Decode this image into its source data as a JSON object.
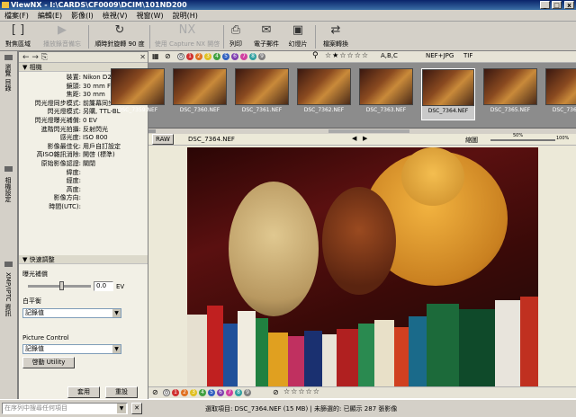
{
  "window": {
    "title": "ViewNX - I:\\CARDS\\CF0009\\DCIM\\101ND200",
    "min": "_",
    "max": "□",
    "close": "x"
  },
  "menu": [
    "檔案(F)",
    "編輯(E)",
    "影像(I)",
    "檢視(V)",
    "視窗(W)",
    "說明(H)"
  ],
  "toolbar": {
    "items": [
      {
        "label": "對焦區域",
        "icon": "[ ]",
        "disabled": false
      },
      {
        "label": "播放錄音備忘",
        "icon": "▶",
        "disabled": true
      },
      {
        "label": "順時針旋轉 90 度",
        "icon": "↻",
        "disabled": false
      },
      {
        "label": "使用 Capture NX 開啓",
        "icon": "NX",
        "disabled": true
      },
      {
        "label": "列印",
        "icon": "⎙",
        "disabled": false
      },
      {
        "label": "電子郵件",
        "icon": "✉",
        "disabled": false
      },
      {
        "label": "幻燈片",
        "icon": "▣",
        "disabled": false
      },
      {
        "label": "檔案轉換",
        "icon": "⇄",
        "disabled": false
      }
    ]
  },
  "left_tabs": [
    "瀏覽 目錄",
    "相機設定",
    "XMP/IPTC 資訊"
  ],
  "camera": {
    "section": "相機",
    "rows": [
      {
        "k": "裝置:",
        "v": "Nikon D200"
      },
      {
        "k": "鏡頭:",
        "v": "30 mm F/1.4 G"
      },
      {
        "k": "焦距:",
        "v": "30 mm"
      },
      {
        "k": "閃光燈同步模式:",
        "v": "前簾幕同步"
      },
      {
        "k": "閃光燈模式:",
        "v": "另購, TTL-BL"
      },
      {
        "k": "閃光燈曝光補償:",
        "v": "0 EV"
      },
      {
        "k": "進階閃光拍攝:",
        "v": "反射閃光"
      },
      {
        "k": "感光度:",
        "v": "ISO 800"
      },
      {
        "k": "影像最佳化:",
        "v": "用戶自訂設定"
      },
      {
        "k": "高ISO雜訊消除:",
        "v": "開啓 (標準)"
      },
      {
        "k": "原始影像認證:",
        "v": "關閉"
      },
      {
        "k": "緯度:",
        "v": ""
      },
      {
        "k": "經度:",
        "v": ""
      },
      {
        "k": "高度:",
        "v": ""
      },
      {
        "k": "影像方向:",
        "v": ""
      },
      {
        "k": "時間(UTC):",
        "v": ""
      }
    ]
  },
  "quick_adjust": {
    "section": "快速調整",
    "exposure_label": "曝光補償",
    "exposure_value": "0.0",
    "exposure_unit": "EV",
    "wb_label": "白平衡",
    "wb_value": "記錄值",
    "pc_label": "Picture Control",
    "pc_value": "記錄值",
    "utility_button": "啓動 Utility",
    "apply_button": "套用",
    "reset_button": "重設"
  },
  "filter_bar": {
    "labels": [
      "0",
      "1",
      "2",
      "3",
      "4",
      "5",
      "6",
      "7",
      "8",
      "9"
    ],
    "abc": "A,B,C",
    "format": "NEF+JPG",
    "tif": "TIF"
  },
  "thumbnails": [
    "DSC_7359.NEF",
    "DSC_7360.NEF",
    "DSC_7361.NEF",
    "DSC_7362.NEF",
    "DSC_7363.NEF",
    "DSC_7364.NEF",
    "DSC_7365.NEF",
    "DSC_7366.NEF"
  ],
  "selected_index": 5,
  "viewer": {
    "raw": "RAW",
    "filename": "DSC_7364.NEF",
    "zoom_label": "縮圖",
    "zoom_min": "50%",
    "zoom_max": "100%"
  },
  "search": {
    "placeholder": "在序列中搜尋任何項目"
  },
  "status": "選取項目: DSC_7364.NEF (15 MB) | 未篩選的: 已顯示 287 張影像",
  "colors": {
    "titlebar": "#0a246a",
    "label_colors": [
      "#ffffff",
      "#d03030",
      "#e07020",
      "#e0c020",
      "#40a040",
      "#3060c0",
      "#8040b0",
      "#d040a0",
      "#30a0a0",
      "#808080"
    ]
  }
}
